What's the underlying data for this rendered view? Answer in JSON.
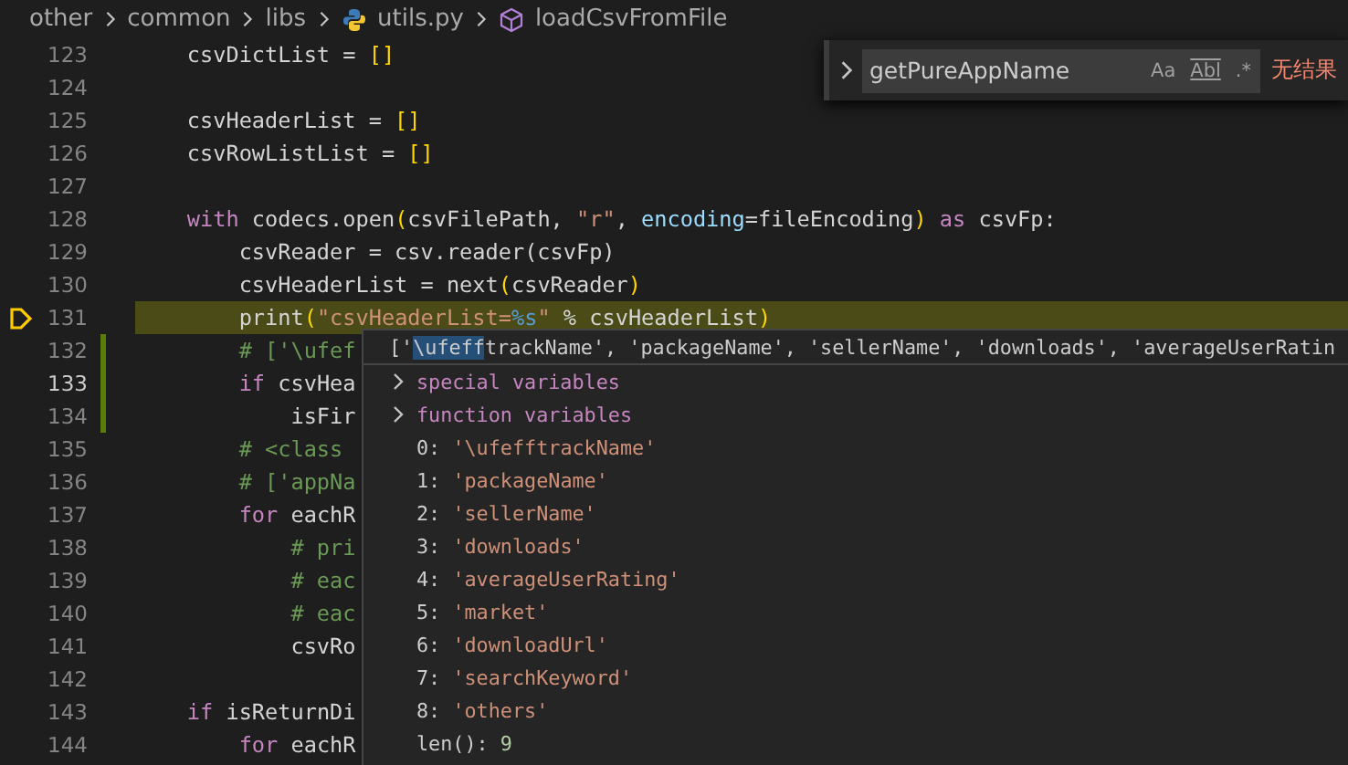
{
  "breadcrumb": [
    {
      "label": "other",
      "kind": "folder"
    },
    {
      "label": "common",
      "kind": "folder"
    },
    {
      "label": "libs",
      "kind": "folder"
    },
    {
      "label": "utils.py",
      "kind": "python"
    },
    {
      "label": "loadCsvFromFile",
      "kind": "symbol"
    }
  ],
  "find_widget": {
    "value": "getPureAppName",
    "options": [
      {
        "label": "Aa",
        "on": false,
        "kind": "case"
      },
      {
        "label": "Abl",
        "on": false,
        "kind": "word"
      },
      {
        "label": ".*",
        "on": false,
        "kind": "regex"
      }
    ],
    "result": "无结果"
  },
  "editor": {
    "lines": [
      {
        "number": "123",
        "paused": false,
        "current": false,
        "modified": false,
        "tokens": [
          {
            "text": "    csvDictList = ",
            "kind": "text"
          },
          {
            "text": "[]",
            "kind": "bracket"
          }
        ]
      },
      {
        "number": "124",
        "paused": false,
        "current": false,
        "modified": false
      },
      {
        "number": "125",
        "paused": false,
        "current": false,
        "modified": false,
        "tokens": [
          {
            "text": "    csvHeaderList = ",
            "kind": "text"
          },
          {
            "text": "[]",
            "kind": "bracket"
          }
        ]
      },
      {
        "number": "126",
        "paused": false,
        "current": false,
        "modified": false,
        "tokens": [
          {
            "text": "    csvRowListList = ",
            "kind": "text"
          },
          {
            "text": "[]",
            "kind": "bracket"
          }
        ]
      },
      {
        "number": "127",
        "paused": false,
        "current": false,
        "modified": false
      },
      {
        "number": "128",
        "paused": false,
        "current": false,
        "modified": false,
        "tokens": [
          {
            "text": "    with",
            "kind": "keyword"
          },
          {
            "text": " codecs.open",
            "kind": "text"
          },
          {
            "text": "(",
            "kind": "bracket"
          },
          {
            "text": "csvFilePath, ",
            "kind": "text"
          },
          {
            "text": "\"r\"",
            "kind": "string"
          },
          {
            "text": ", ",
            "kind": "text"
          },
          {
            "text": "encoding",
            "kind": "param"
          },
          {
            "text": "=fileEncoding",
            "kind": "text"
          },
          {
            "text": ")",
            "kind": "bracket"
          },
          {
            "text": " as",
            "kind": "keyword"
          },
          {
            "text": " csvFp:",
            "kind": "text"
          }
        ]
      },
      {
        "number": "129",
        "paused": false,
        "current": false,
        "modified": false,
        "tokens": [
          {
            "text": "        csvReader = csv.reader(csvFp)",
            "kind": "text"
          }
        ]
      },
      {
        "number": "130",
        "paused": false,
        "current": false,
        "modified": false,
        "tokens": [
          {
            "text": "        csvHeaderList = next",
            "kind": "text"
          },
          {
            "text": "(",
            "kind": "bracket"
          },
          {
            "text": "csvReader",
            "kind": "text"
          },
          {
            "text": ")",
            "kind": "bracket"
          }
        ]
      },
      {
        "number": "131",
        "paused": true,
        "current": false,
        "modified": false,
        "tokens": [
          {
            "text": "        print",
            "kind": "text"
          },
          {
            "text": "(",
            "kind": "bracket"
          },
          {
            "text": "\"csvHeaderList=",
            "kind": "string"
          },
          {
            "text": "%s",
            "kind": "format"
          },
          {
            "text": "\"",
            "kind": "string"
          },
          {
            "text": " % csvHeaderList",
            "kind": "text"
          },
          {
            "text": ")",
            "kind": "bracket"
          }
        ]
      },
      {
        "number": "132",
        "paused": false,
        "current": false,
        "modified": true,
        "tokens": [
          {
            "text": "        # ['\\ufef",
            "kind": "comment"
          }
        ]
      },
      {
        "number": "133",
        "paused": false,
        "current": true,
        "modified": true,
        "tokens": [
          {
            "text": "        if",
            "kind": "keyword"
          },
          {
            "text": " csvHea",
            "kind": "text"
          }
        ]
      },
      {
        "number": "134",
        "paused": false,
        "current": false,
        "modified": true,
        "tokens": [
          {
            "text": "            isFir",
            "kind": "text"
          }
        ]
      },
      {
        "number": "135",
        "paused": false,
        "current": false,
        "modified": false,
        "tokens": [
          {
            "text": "        # <class",
            "kind": "comment"
          }
        ]
      },
      {
        "number": "136",
        "paused": false,
        "current": false,
        "modified": false,
        "tokens": [
          {
            "text": "        # ['appNa",
            "kind": "comment"
          }
        ]
      },
      {
        "number": "137",
        "paused": false,
        "current": false,
        "modified": false,
        "tokens": [
          {
            "text": "        for",
            "kind": "keyword"
          },
          {
            "text": " eachR",
            "kind": "text"
          }
        ]
      },
      {
        "number": "138",
        "paused": false,
        "current": false,
        "modified": false,
        "tokens": [
          {
            "text": "            # pri",
            "kind": "comment"
          }
        ]
      },
      {
        "number": "139",
        "paused": false,
        "current": false,
        "modified": false,
        "tokens": [
          {
            "text": "            # eac",
            "kind": "comment"
          }
        ]
      },
      {
        "number": "140",
        "paused": false,
        "current": false,
        "modified": false,
        "tokens": [
          {
            "text": "            # eac",
            "kind": "comment"
          }
        ]
      },
      {
        "number": "141",
        "paused": false,
        "current": false,
        "modified": false,
        "tokens": [
          {
            "text": "            csvRo",
            "kind": "text"
          }
        ]
      },
      {
        "number": "142",
        "paused": false,
        "current": false,
        "modified": false
      },
      {
        "number": "143",
        "paused": false,
        "current": false,
        "modified": false,
        "tokens": [
          {
            "text": "    if",
            "kind": "keyword"
          },
          {
            "text": " isReturnDi",
            "kind": "text"
          }
        ]
      },
      {
        "number": "144",
        "paused": false,
        "current": false,
        "modified": false,
        "tokens": [
          {
            "text": "        for",
            "kind": "keyword"
          },
          {
            "text": " eachR",
            "kind": "text"
          }
        ]
      }
    ]
  },
  "hover": {
    "header": [
      {
        "text": "['",
        "selected": false
      },
      {
        "text": "\\ufeff",
        "selected": true
      },
      {
        "text": "trackName', 'packageName', 'sellerName', 'downloads', 'averageUserRatin",
        "selected": false
      }
    ],
    "groups": [
      {
        "label": "special variables",
        "expanded": false
      },
      {
        "label": "function variables",
        "expanded": false
      }
    ],
    "items": [
      {
        "key": "0:",
        "value": "'\\ufefftrackName'"
      },
      {
        "key": "1:",
        "value": "'packageName'"
      },
      {
        "key": "2:",
        "value": "'sellerName'"
      },
      {
        "key": "3:",
        "value": "'downloads'"
      },
      {
        "key": "4:",
        "value": "'averageUserRating'"
      },
      {
        "key": "5:",
        "value": "'market'"
      },
      {
        "key": "6:",
        "value": "'downloadUrl'"
      },
      {
        "key": "7:",
        "value": "'searchKeyword'"
      },
      {
        "key": "8:",
        "value": "'others'"
      }
    ],
    "length": {
      "key": "len():",
      "value": "9"
    }
  }
}
